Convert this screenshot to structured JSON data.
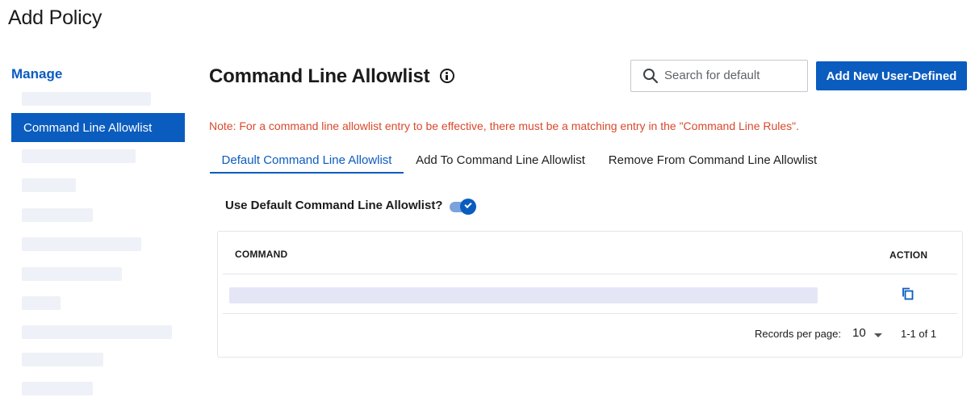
{
  "page": {
    "title": "Add Policy"
  },
  "sidebar": {
    "heading": "Manage",
    "active_item": "Command Line Allowlist"
  },
  "main": {
    "title": "Command Line Allowlist",
    "search": {
      "placeholder": "Search for default",
      "value": ""
    },
    "add_button_label": "Add New User-Defined",
    "note": "Note: For a command line allowlist entry to be effective, there must be a matching entry in the \"Command Line Rules\".",
    "tabs": [
      {
        "label": "Default Command Line Allowlist",
        "active": true
      },
      {
        "label": "Add To Command Line Allowlist",
        "active": false
      },
      {
        "label": "Remove From Command Line Allowlist",
        "active": false
      }
    ],
    "toggle": {
      "label": "Use Default Command Line Allowlist?",
      "checked": true
    },
    "table": {
      "columns": [
        "COMMAND",
        "ACTION"
      ],
      "pagination": {
        "records_per_page_label": "Records per page:",
        "records_per_page": "10",
        "range": "1-1 of 1"
      }
    }
  },
  "colors": {
    "accent": "#0b5cbf",
    "note": "#d9492c"
  }
}
